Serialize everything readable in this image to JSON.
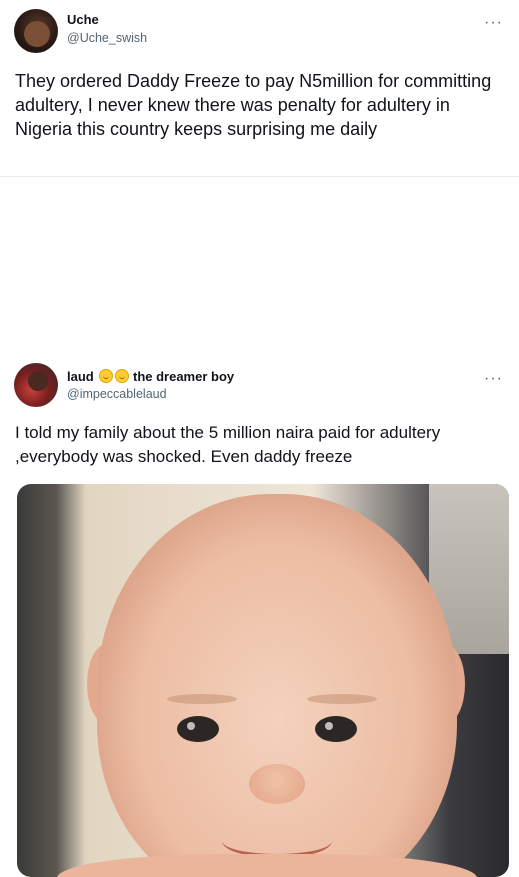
{
  "tweet1": {
    "name": "Uche",
    "handle": "@Uche_swish",
    "more": "···",
    "text": "They ordered Daddy Freeze to pay  N5million for committing adultery, I never knew there was penalty for adultery in Nigeria this country keeps surprising me daily"
  },
  "tweet2": {
    "name": "laud",
    "name_suffix": "the dreamer boy",
    "emojis": [
      "smiling-face-emoji",
      "smiling-face-emoji"
    ],
    "handle": "@impeccablelaud",
    "more": "···",
    "text": "I told my family about the 5 million naira paid for adultery ,everybody was shocked. Even daddy freeze",
    "image": "baby-smirk-photo"
  },
  "colors": {
    "text": "#0f1419",
    "secondary": "#536471",
    "divider": "#e6ecf0",
    "emoji": "#ffcc33"
  }
}
